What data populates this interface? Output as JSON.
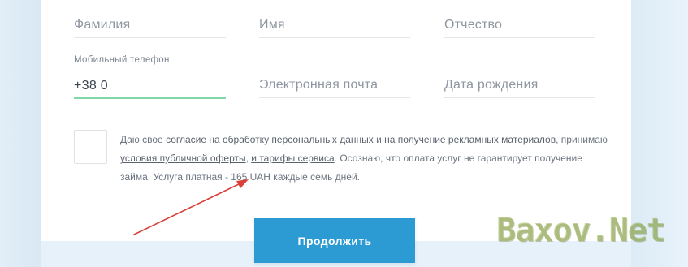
{
  "form": {
    "last_name_placeholder": "Фамилия",
    "first_name_placeholder": "Имя",
    "middle_name_placeholder": "Отчество",
    "phone_label": "Мобильный телефон",
    "phone_value": "+38 0",
    "email_placeholder": "Электронная почта",
    "birthdate_placeholder": "Дата рождения"
  },
  "consent": {
    "text_1": "Даю свое ",
    "link_personal_data": "согласие на обработку персональных данных",
    "text_2": " и ",
    "link_ads": "на получение рекламных материалов",
    "text_3": ", принимаю ",
    "link_offer": "условия публичной оферты",
    "text_4": ", ",
    "link_tariffs": "и тарифы сервиса",
    "text_5": ". Осознаю, что оплата услуг не гарантирует получение займа. Услуга платная - 165 UAH каждые семь дней."
  },
  "submit_label": "Продолжить",
  "watermark": "Baxov.Net",
  "colors": {
    "accent": "#2c9ad3",
    "active_underline": "#7ed9a6",
    "annotation_arrow": "#d9403a"
  }
}
